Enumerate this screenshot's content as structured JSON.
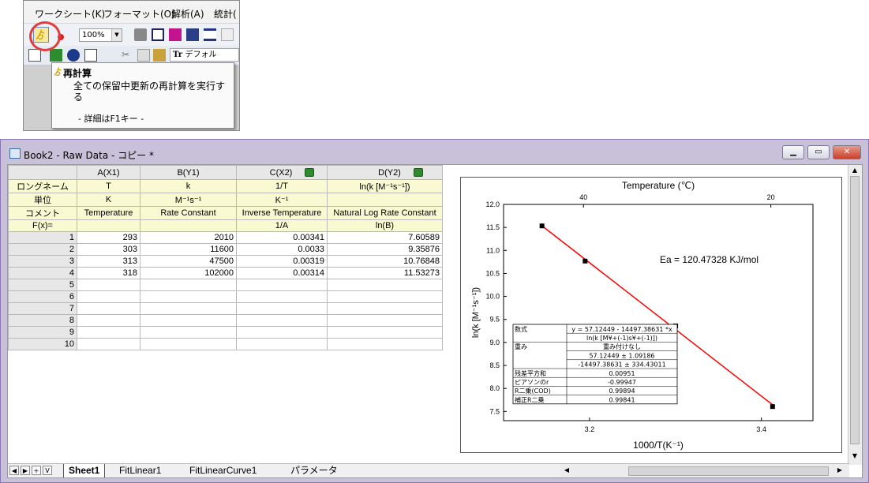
{
  "menu": [
    "ワークシート(K)",
    "フォーマット(O)",
    "解析(A)",
    "統計("
  ],
  "toolbar": {
    "zoom": "100%",
    "font_name": "デフォル"
  },
  "tooltip": {
    "title": "再計算",
    "description": "全ての保留中更新の再計算を実行する",
    "help": "- 詳細はF1キー -"
  },
  "workbook": {
    "title": "Book2 - Raw Data - コピー *",
    "columns": [
      "A(X1)",
      "B(Y1)",
      "C(X2)",
      "D(Y2)"
    ],
    "meta_rows": [
      {
        "label": "ロングネーム",
        "cells": [
          "T",
          "k",
          "1/T",
          "ln(k [M⁻¹s⁻¹])"
        ]
      },
      {
        "label": "単位",
        "cells": [
          "K",
          "M⁻¹s⁻¹",
          "K⁻¹",
          ""
        ]
      },
      {
        "label": "コメント",
        "cells": [
          "Temperature",
          "Rate Constant",
          "Inverse Temperature",
          "Natural Log Rate Constant"
        ]
      },
      {
        "label": "F(x)=",
        "cells": [
          "",
          "",
          "1/A",
          "ln(B)"
        ]
      }
    ],
    "rows": [
      [
        "1",
        "293",
        "2010",
        "0.00341",
        "7.60589"
      ],
      [
        "2",
        "303",
        "11600",
        "0.0033",
        "9.35876"
      ],
      [
        "3",
        "313",
        "47500",
        "0.00319",
        "10.76848"
      ],
      [
        "4",
        "318",
        "102000",
        "0.00314",
        "11.53273"
      ],
      [
        "5",
        "",
        "",
        "",
        ""
      ],
      [
        "6",
        "",
        "",
        "",
        ""
      ],
      [
        "7",
        "",
        "",
        "",
        ""
      ],
      [
        "8",
        "",
        "",
        "",
        ""
      ],
      [
        "9",
        "",
        "",
        "",
        ""
      ],
      [
        "10",
        "",
        "",
        "",
        ""
      ]
    ],
    "tabs": [
      "Sheet1",
      "FitLinear1",
      "FitLinearCurve1",
      "パラメータ"
    ]
  },
  "chart_data": {
    "type": "scatter",
    "xlabel": "1000/T(K⁻¹)",
    "ylabel": "ln(k [M⁻¹s⁻¹])",
    "top_axis_label": "Temperature (℃)",
    "top_ticks": [
      "40",
      "20"
    ],
    "top_tick_values": [
      3.193,
      3.411
    ],
    "x_ticks": [
      "3.2",
      "3.4"
    ],
    "xlim": [
      3.1,
      3.46
    ],
    "ylim": [
      7.3,
      12.0
    ],
    "y_ticks": [
      "12.0",
      "11.5",
      "11.0",
      "10.5",
      "10.0",
      "9.5",
      "9.0",
      "8.5",
      "8.0",
      "7.5"
    ],
    "points": [
      {
        "x": 3.1447,
        "y": 11.53273
      },
      {
        "x": 3.1949,
        "y": 10.76848
      },
      {
        "x": 3.3003,
        "y": 9.35876
      },
      {
        "x": 3.413,
        "y": 7.60589
      }
    ],
    "fit": {
      "intercept": 57.12449,
      "slope": -14.49738631,
      "color": "#ff0000"
    },
    "annotation": "Ea = 120.47328 KJ/mol",
    "fit_table": [
      [
        "数式",
        "y = 57.12449 - 14497.38631 *x"
      ],
      [
        "",
        "ln(k [M¥+(-1)s¥+(-1)])"
      ],
      [
        "重み",
        "重み付けなし"
      ],
      [
        "",
        "57.12449  ±  1.09186"
      ],
      [
        "",
        "-14497.38631  ±  334.43011"
      ],
      [
        "残差平方和",
        "0.00951"
      ],
      [
        "ピアソンのr",
        "-0.99947"
      ],
      [
        "R二乗(COD)",
        "0.99894"
      ],
      [
        "補正R二乗",
        "0.99841"
      ]
    ]
  }
}
